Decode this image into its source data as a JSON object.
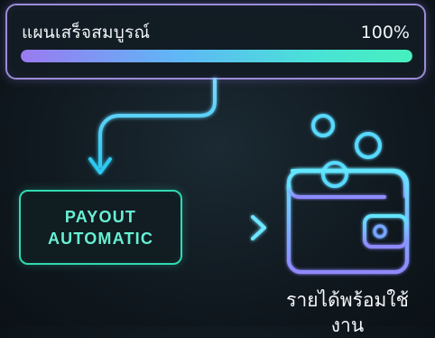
{
  "progress": {
    "title": "แผนเสร็จสมบูรณ์",
    "percent_label": "100%",
    "value": 100
  },
  "payout": {
    "label": "PAYOUT\nAUTOMATIC"
  },
  "wallet": {
    "caption": "รายได้พร้อมใช้งาน",
    "icon": "wallet-with-coins-icon"
  },
  "colors": {
    "progress_border": "#9b8cd8",
    "progress_gradient_start": "#9a7af0",
    "progress_gradient_end": "#46f0be",
    "payout_accent": "#31d9b2",
    "arrow_color": "#49c9f0"
  }
}
